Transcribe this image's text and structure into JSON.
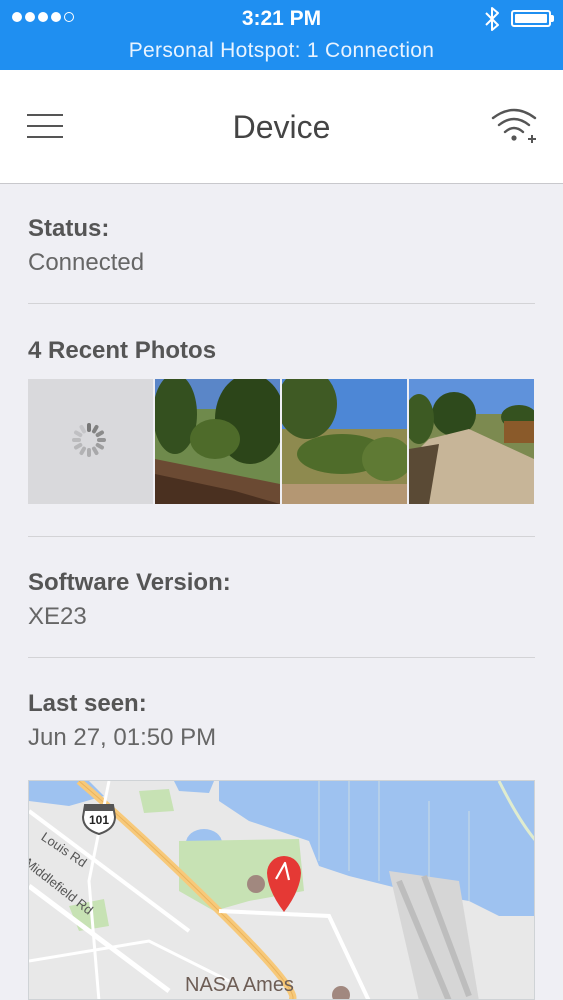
{
  "status_bar": {
    "time": "3:21 PM",
    "hotspot": "Personal Hotspot: 1 Connection",
    "signal_icon": "signal-dots-icon",
    "bluetooth_icon": "bluetooth-icon",
    "battery_icon": "battery-icon"
  },
  "navbar": {
    "title": "Device",
    "menu_icon": "hamburger-menu-icon",
    "right_icon": "wifi-add-icon"
  },
  "status": {
    "label": "Status:",
    "value": "Connected"
  },
  "photos": {
    "label": "4 Recent Photos",
    "items": [
      "loading",
      "trail-trees",
      "hillside-brush",
      "dirt-trail"
    ]
  },
  "software": {
    "label": "Software Version:",
    "value": "XE23"
  },
  "last_seen": {
    "label": "Last seen:",
    "value": "Jun 27, 01:50 PM"
  },
  "map": {
    "shield": "101",
    "roads": [
      "Louis Rd",
      "Middlefield Rd"
    ],
    "place": "NASA Ames",
    "marker_icon": "map-pin-icon"
  },
  "colors": {
    "status_bar_bg": "#1f8ff1",
    "background": "#efeff4",
    "pin": "#e53935"
  }
}
